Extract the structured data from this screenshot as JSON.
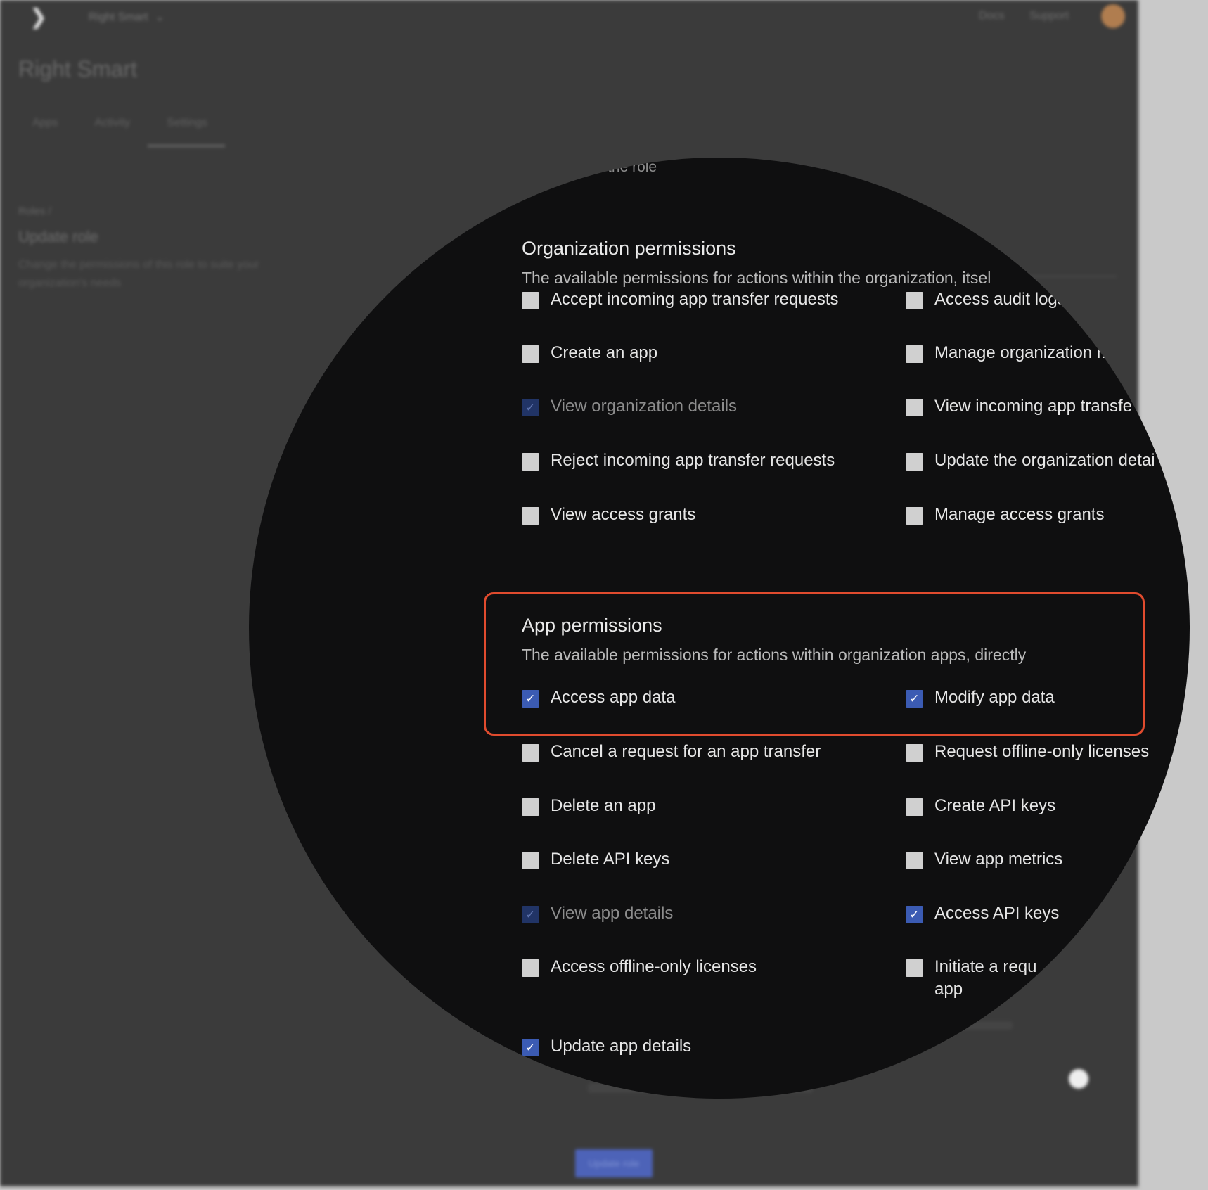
{
  "background_app": {
    "org_name": "Right Smart",
    "nav": {
      "docs": "Docs",
      "support": "Support"
    },
    "page_title": "Right Smart",
    "tabs": [
      "Apps",
      "Activity",
      "Settings"
    ],
    "breadcrumb": "Roles /",
    "side_title": "Update role",
    "side_description": "Change the permissions of this role to suite your organization's needs",
    "update_button": "Update role"
  },
  "magnifier": {
    "role_name_hint": "y name of the role",
    "organization_permissions": {
      "title": "Organization permissions",
      "description": "The available permissions for actions within the organization, itsel",
      "items": [
        {
          "label": "Accept incoming app transfer requests",
          "checked": false,
          "disabled": false
        },
        {
          "label": "Access audit logs",
          "checked": false,
          "disabled": false
        },
        {
          "label": "Create an app",
          "checked": false,
          "disabled": false
        },
        {
          "label": "Manage organization m",
          "checked": false,
          "disabled": false
        },
        {
          "label": "View organization details",
          "checked": true,
          "disabled": true
        },
        {
          "label": "View incoming app transfe",
          "checked": false,
          "disabled": false
        },
        {
          "label": "Reject incoming app transfer requests",
          "checked": false,
          "disabled": false
        },
        {
          "label": "Update the organization detai",
          "checked": false,
          "disabled": false
        },
        {
          "label": "View access grants",
          "checked": false,
          "disabled": false
        },
        {
          "label": "Manage access grants",
          "checked": false,
          "disabled": false
        }
      ]
    },
    "app_permissions": {
      "title": "App permissions",
      "description": "The available permissions for actions within organization apps, directly",
      "items": [
        {
          "label": "Access app data",
          "checked": true,
          "disabled": false
        },
        {
          "label": "Modify app data",
          "checked": true,
          "disabled": false
        },
        {
          "label": "Cancel a request for an app transfer",
          "checked": false,
          "disabled": false
        },
        {
          "label": "Request offline-only licenses",
          "checked": false,
          "disabled": false
        },
        {
          "label": "Delete an app",
          "checked": false,
          "disabled": false
        },
        {
          "label": "Create API keys",
          "checked": false,
          "disabled": false
        },
        {
          "label": "Delete API keys",
          "checked": false,
          "disabled": false
        },
        {
          "label": "View app metrics",
          "checked": false,
          "disabled": false
        },
        {
          "label": "View app details",
          "checked": true,
          "disabled": true
        },
        {
          "label": "Access API keys",
          "checked": true,
          "disabled": false
        },
        {
          "label": "Access offline-only licenses",
          "checked": false,
          "disabled": false
        },
        {
          "label": "Initiate a requ app",
          "checked": false,
          "disabled": false
        },
        {
          "label": "Update app details",
          "checked": true,
          "disabled": false
        }
      ]
    },
    "check_glyph": "✓"
  },
  "colors": {
    "highlight": "#e04b2e",
    "checkbox_checked": "#3b5bb3",
    "checkbox_unchecked": "#d0d0d0"
  }
}
